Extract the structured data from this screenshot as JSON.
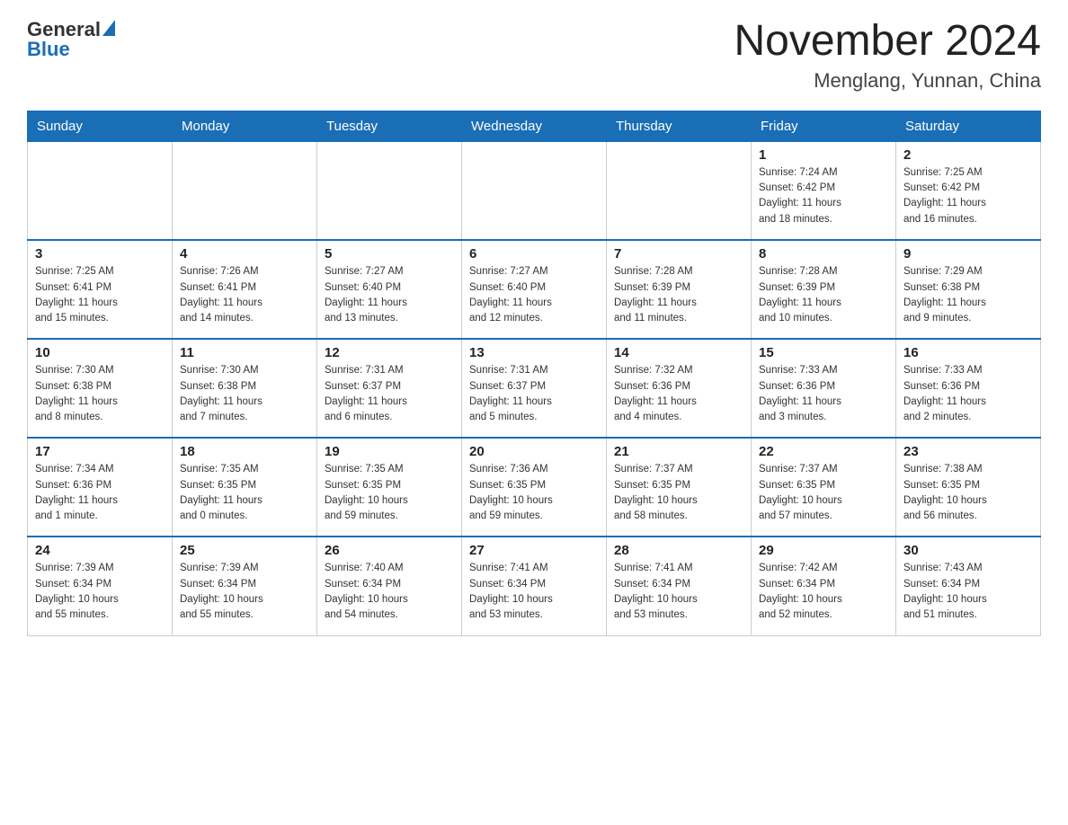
{
  "logo": {
    "general": "General",
    "blue": "Blue",
    "triangle": "▶"
  },
  "title": {
    "month_year": "November 2024",
    "location": "Menglang, Yunnan, China"
  },
  "weekdays": [
    "Sunday",
    "Monday",
    "Tuesday",
    "Wednesday",
    "Thursday",
    "Friday",
    "Saturday"
  ],
  "weeks": [
    [
      {
        "day": "",
        "info": ""
      },
      {
        "day": "",
        "info": ""
      },
      {
        "day": "",
        "info": ""
      },
      {
        "day": "",
        "info": ""
      },
      {
        "day": "",
        "info": ""
      },
      {
        "day": "1",
        "info": "Sunrise: 7:24 AM\nSunset: 6:42 PM\nDaylight: 11 hours\nand 18 minutes."
      },
      {
        "day": "2",
        "info": "Sunrise: 7:25 AM\nSunset: 6:42 PM\nDaylight: 11 hours\nand 16 minutes."
      }
    ],
    [
      {
        "day": "3",
        "info": "Sunrise: 7:25 AM\nSunset: 6:41 PM\nDaylight: 11 hours\nand 15 minutes."
      },
      {
        "day": "4",
        "info": "Sunrise: 7:26 AM\nSunset: 6:41 PM\nDaylight: 11 hours\nand 14 minutes."
      },
      {
        "day": "5",
        "info": "Sunrise: 7:27 AM\nSunset: 6:40 PM\nDaylight: 11 hours\nand 13 minutes."
      },
      {
        "day": "6",
        "info": "Sunrise: 7:27 AM\nSunset: 6:40 PM\nDaylight: 11 hours\nand 12 minutes."
      },
      {
        "day": "7",
        "info": "Sunrise: 7:28 AM\nSunset: 6:39 PM\nDaylight: 11 hours\nand 11 minutes."
      },
      {
        "day": "8",
        "info": "Sunrise: 7:28 AM\nSunset: 6:39 PM\nDaylight: 11 hours\nand 10 minutes."
      },
      {
        "day": "9",
        "info": "Sunrise: 7:29 AM\nSunset: 6:38 PM\nDaylight: 11 hours\nand 9 minutes."
      }
    ],
    [
      {
        "day": "10",
        "info": "Sunrise: 7:30 AM\nSunset: 6:38 PM\nDaylight: 11 hours\nand 8 minutes."
      },
      {
        "day": "11",
        "info": "Sunrise: 7:30 AM\nSunset: 6:38 PM\nDaylight: 11 hours\nand 7 minutes."
      },
      {
        "day": "12",
        "info": "Sunrise: 7:31 AM\nSunset: 6:37 PM\nDaylight: 11 hours\nand 6 minutes."
      },
      {
        "day": "13",
        "info": "Sunrise: 7:31 AM\nSunset: 6:37 PM\nDaylight: 11 hours\nand 5 minutes."
      },
      {
        "day": "14",
        "info": "Sunrise: 7:32 AM\nSunset: 6:36 PM\nDaylight: 11 hours\nand 4 minutes."
      },
      {
        "day": "15",
        "info": "Sunrise: 7:33 AM\nSunset: 6:36 PM\nDaylight: 11 hours\nand 3 minutes."
      },
      {
        "day": "16",
        "info": "Sunrise: 7:33 AM\nSunset: 6:36 PM\nDaylight: 11 hours\nand 2 minutes."
      }
    ],
    [
      {
        "day": "17",
        "info": "Sunrise: 7:34 AM\nSunset: 6:36 PM\nDaylight: 11 hours\nand 1 minute."
      },
      {
        "day": "18",
        "info": "Sunrise: 7:35 AM\nSunset: 6:35 PM\nDaylight: 11 hours\nand 0 minutes."
      },
      {
        "day": "19",
        "info": "Sunrise: 7:35 AM\nSunset: 6:35 PM\nDaylight: 10 hours\nand 59 minutes."
      },
      {
        "day": "20",
        "info": "Sunrise: 7:36 AM\nSunset: 6:35 PM\nDaylight: 10 hours\nand 59 minutes."
      },
      {
        "day": "21",
        "info": "Sunrise: 7:37 AM\nSunset: 6:35 PM\nDaylight: 10 hours\nand 58 minutes."
      },
      {
        "day": "22",
        "info": "Sunrise: 7:37 AM\nSunset: 6:35 PM\nDaylight: 10 hours\nand 57 minutes."
      },
      {
        "day": "23",
        "info": "Sunrise: 7:38 AM\nSunset: 6:35 PM\nDaylight: 10 hours\nand 56 minutes."
      }
    ],
    [
      {
        "day": "24",
        "info": "Sunrise: 7:39 AM\nSunset: 6:34 PM\nDaylight: 10 hours\nand 55 minutes."
      },
      {
        "day": "25",
        "info": "Sunrise: 7:39 AM\nSunset: 6:34 PM\nDaylight: 10 hours\nand 55 minutes."
      },
      {
        "day": "26",
        "info": "Sunrise: 7:40 AM\nSunset: 6:34 PM\nDaylight: 10 hours\nand 54 minutes."
      },
      {
        "day": "27",
        "info": "Sunrise: 7:41 AM\nSunset: 6:34 PM\nDaylight: 10 hours\nand 53 minutes."
      },
      {
        "day": "28",
        "info": "Sunrise: 7:41 AM\nSunset: 6:34 PM\nDaylight: 10 hours\nand 53 minutes."
      },
      {
        "day": "29",
        "info": "Sunrise: 7:42 AM\nSunset: 6:34 PM\nDaylight: 10 hours\nand 52 minutes."
      },
      {
        "day": "30",
        "info": "Sunrise: 7:43 AM\nSunset: 6:34 PM\nDaylight: 10 hours\nand 51 minutes."
      }
    ]
  ]
}
